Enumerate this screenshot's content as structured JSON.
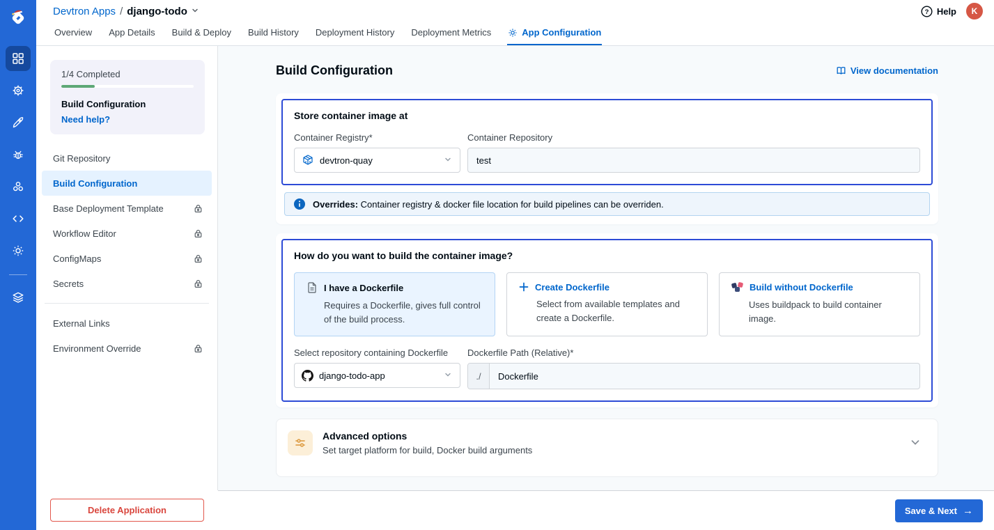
{
  "header": {
    "breadcrumb": {
      "root": "Devtron Apps",
      "separator": "/",
      "app": "django-todo"
    },
    "help_label": "Help",
    "avatar_initial": "K",
    "tabs": [
      {
        "label": "Overview",
        "active": false
      },
      {
        "label": "App Details",
        "active": false
      },
      {
        "label": "Build & Deploy",
        "active": false
      },
      {
        "label": "Build History",
        "active": false
      },
      {
        "label": "Deployment History",
        "active": false
      },
      {
        "label": "Deployment Metrics",
        "active": false
      },
      {
        "label": "App Configuration",
        "active": true
      }
    ]
  },
  "rail": {
    "icons": [
      "grid",
      "helm-wheel",
      "rocket",
      "bug",
      "cluster",
      "code",
      "gear",
      "stack"
    ]
  },
  "left_panel": {
    "progress": {
      "completed_label": "1/4 Completed",
      "percent": 25,
      "section_title": "Build Configuration",
      "help_link": "Need help?"
    },
    "nav": [
      {
        "label": "Git Repository",
        "active": false,
        "locked": false
      },
      {
        "label": "Build Configuration",
        "active": true,
        "locked": false
      },
      {
        "label": "Base Deployment Template",
        "active": false,
        "locked": true
      },
      {
        "label": "Workflow Editor",
        "active": false,
        "locked": true
      },
      {
        "label": "ConfigMaps",
        "active": false,
        "locked": true
      },
      {
        "label": "Secrets",
        "active": false,
        "locked": true
      }
    ],
    "nav_secondary": [
      {
        "label": "External Links",
        "active": false,
        "locked": false
      },
      {
        "label": "Environment Override",
        "active": false,
        "locked": true
      }
    ]
  },
  "main": {
    "title": "Build Configuration",
    "doc_link": "View documentation",
    "store_card": {
      "title": "Store container image at",
      "registry_label": "Container Registry*",
      "registry_value": "devtron-quay",
      "repo_label": "Container Repository",
      "repo_value": "test"
    },
    "overrides_banner": {
      "bold": "Overrides:",
      "text": "Container registry & docker file location for build pipelines can be overriden."
    },
    "build_card": {
      "title": "How do you want to build the container image?",
      "options": [
        {
          "title": "I have a Dockerfile",
          "desc": "Requires a Dockerfile, gives full control of the build process.",
          "selected": true
        },
        {
          "title": "Create Dockerfile",
          "desc": "Select from available templates and create a Dockerfile.",
          "selected": false
        },
        {
          "title": "Build without Dockerfile",
          "desc": "Uses buildpack to build container image.",
          "selected": false
        }
      ],
      "repo_select_label": "Select repository containing Dockerfile",
      "repo_select_value": "django-todo-app",
      "path_label": "Dockerfile Path (Relative)*",
      "path_prefix": "./",
      "path_value": "Dockerfile"
    },
    "advanced": {
      "title": "Advanced options",
      "subtitle": "Set target platform for build, Docker build arguments"
    }
  },
  "footer": {
    "delete_label": "Delete Application",
    "save_label": "Save & Next",
    "save_arrow": "→"
  },
  "colors": {
    "primary_blue": "#0066CC",
    "rail_blue": "#2368D6",
    "selection_border_blue": "#2D4BD6",
    "progress_green": "#5EA876",
    "avatar_red": "#D65745",
    "danger_red": "#D9463D",
    "banner_bg": "#EEF5FC",
    "active_nav_bg": "#E5F2FF",
    "page_bg": "#F7FAFC"
  }
}
